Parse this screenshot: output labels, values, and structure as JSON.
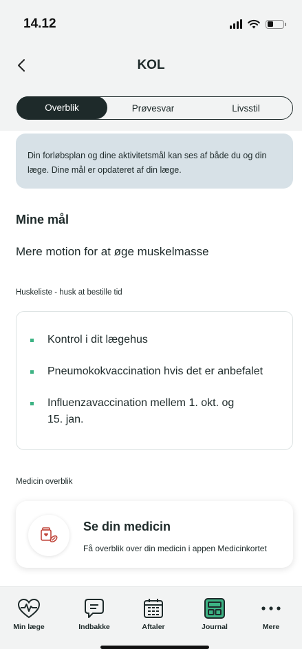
{
  "status_bar": {
    "time": "14.12"
  },
  "nav": {
    "title": "KOL"
  },
  "tabs": [
    {
      "label": "Overblik",
      "active": true
    },
    {
      "label": "Prøvesvar",
      "active": false
    },
    {
      "label": "Livsstil",
      "active": false
    }
  ],
  "info": {
    "line1": "Din forløbsplan og dine aktivitetsmål kan ses af både du og din",
    "line2": "læge. Dine mål er opdateret af din læge."
  },
  "goals": {
    "heading": "Mine mål",
    "goal": "Mere motion for at øge muskelmasse"
  },
  "reminders": {
    "label": "Huskeliste - husk at bestille tid",
    "items": [
      {
        "line1": "Kontrol i dit lægehus"
      },
      {
        "line1": "Pneumokokvaccination hvis det er anbefalet"
      },
      {
        "line1": "Influenzavaccination mellem 1. okt. og",
        "line2": "15. jan."
      }
    ]
  },
  "medicine": {
    "label": "Medicin overblik",
    "title": "Se din medicin",
    "subtitle": "Få overblik over din medicin i appen Medicinkortet"
  },
  "tabbar": [
    {
      "label": "Min læge",
      "icon": "heart-pulse-icon"
    },
    {
      "label": "Indbakke",
      "icon": "message-icon"
    },
    {
      "label": "Aftaler",
      "icon": "calendar-icon"
    },
    {
      "label": "Journal",
      "icon": "journal-icon",
      "active": true
    },
    {
      "label": "Mere",
      "icon": "more-icon"
    }
  ],
  "colors": {
    "dark": "#1e2a2a",
    "accent_green": "#3db384",
    "info_bg": "#d7e1e7",
    "med_red": "#c0453a"
  }
}
